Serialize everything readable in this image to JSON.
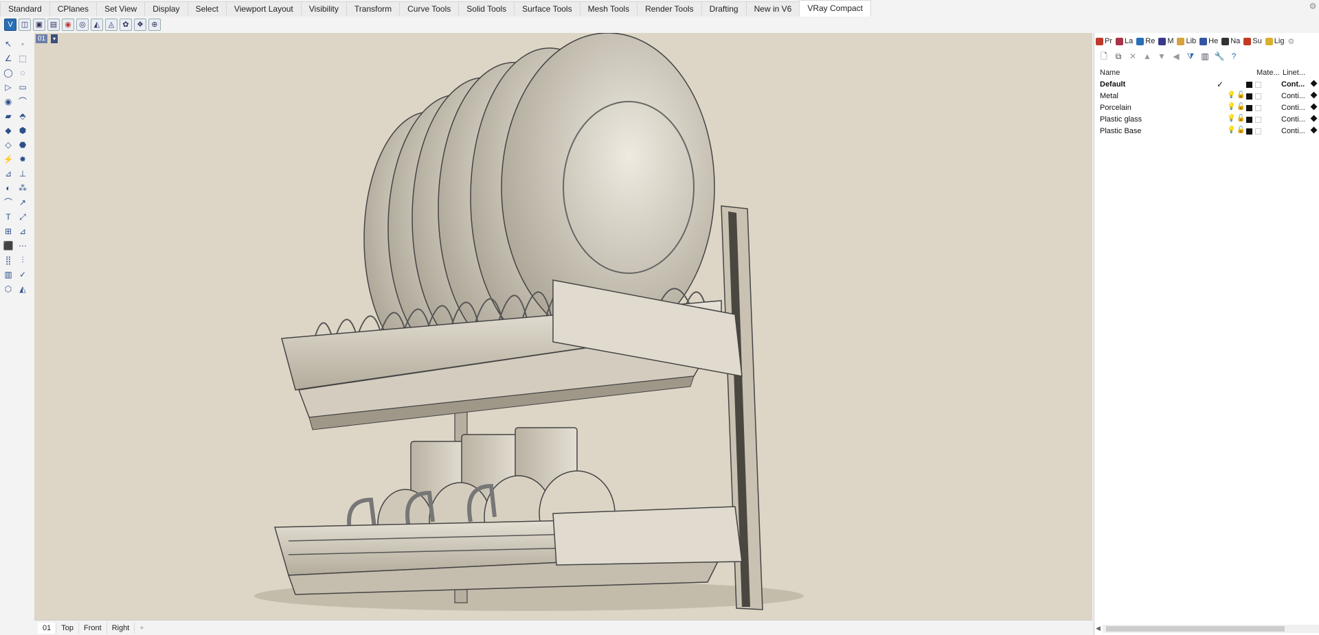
{
  "menu_tabs": [
    "Standard",
    "CPlanes",
    "Set View",
    "Display",
    "Select",
    "Viewport Layout",
    "Visibility",
    "Transform",
    "Curve Tools",
    "Solid Tools",
    "Surface Tools",
    "Mesh Tools",
    "Render Tools",
    "Drafting",
    "New in V6",
    "VRay Compact"
  ],
  "active_menu_tab": "VRay Compact",
  "viewport": {
    "title": "01",
    "tabs": [
      "01",
      "Top",
      "Front",
      "Right"
    ],
    "add_tab_icon": "+"
  },
  "panel_tabs": [
    {
      "label": "Pr",
      "icon": "properties-icon",
      "color": "#c0392b"
    },
    {
      "label": "La",
      "icon": "layers-icon",
      "color": "#a8334a"
    },
    {
      "label": "Re",
      "icon": "render-icon",
      "color": "#2a6fb5"
    },
    {
      "label": "M",
      "icon": "materials-icon",
      "color": "#3a3a8a"
    },
    {
      "label": "Lib",
      "icon": "libraries-icon",
      "color": "#d6a23a"
    },
    {
      "label": "He",
      "icon": "help-icon",
      "color": "#3456a0"
    },
    {
      "label": "Na",
      "icon": "named-views-icon",
      "color": "#333"
    },
    {
      "label": "Su",
      "icon": "sun-icon",
      "color": "#c23b22"
    },
    {
      "label": "Lig",
      "icon": "lights-icon",
      "color": "#d8b030"
    }
  ],
  "layers": {
    "columns": {
      "name": "Name",
      "material": "Mate...",
      "linetype": "Linet..."
    },
    "rows": [
      {
        "name": "Default",
        "current": true,
        "linetype": "Cont..."
      },
      {
        "name": "Metal",
        "current": false,
        "linetype": "Conti..."
      },
      {
        "name": "Porcelain",
        "current": false,
        "linetype": "Conti..."
      },
      {
        "name": "Plastic glass",
        "current": false,
        "linetype": "Conti..."
      },
      {
        "name": "Plastic Base",
        "current": false,
        "linetype": "Conti..."
      }
    ],
    "check_mark": "✓"
  }
}
